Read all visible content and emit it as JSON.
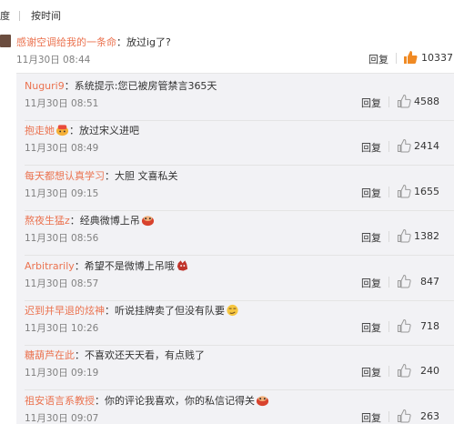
{
  "sort": {
    "by_heat": "度",
    "by_time": "按时间"
  },
  "main": {
    "user": "感谢空调给我的一条命",
    "text": "：放过ig了?",
    "time": "11月30日 08:44",
    "reply": "回复",
    "likes": "10337",
    "like_color": "#f08a24"
  },
  "replies": [
    {
      "user": "Nuguri9",
      "text": "：系统提示:您已被房管禁言365天",
      "time": "11月30日 08:51",
      "reply": "回复",
      "likes": "4588",
      "emoji": ""
    },
    {
      "user": "抱走她",
      "text": "：放过宋义进吧",
      "time": "11月30日 08:49",
      "reply": "回复",
      "likes": "2414",
      "emoji": "badge-icon"
    },
    {
      "user": "每天都想认真学习",
      "text": "：大胆 文喜私关",
      "time": "11月30日 09:15",
      "reply": "回复",
      "likes": "1655",
      "emoji": ""
    },
    {
      "user": "熬夜生猛z",
      "text": "：经典微博上吊",
      "time": "11月30日 08:56",
      "reply": "回复",
      "likes": "1382",
      "emoji": "doge-red-icon"
    },
    {
      "user": "Arbitrarily",
      "text": "：希望不是微博上吊哦",
      "time": "11月30日 08:57",
      "reply": "回复",
      "likes": "847",
      "emoji": "monster-icon"
    },
    {
      "user": "迟到并早退的炫神",
      "text": "：听说挂牌卖了但没有队要",
      "time": "11月30日 10:26",
      "reply": "回复",
      "likes": "718",
      "emoji": "smirk-icon"
    },
    {
      "user": "糖葫芦在此",
      "text": "：不喜欢还天天看，有点贱了",
      "time": "11月30日 09:19",
      "reply": "回复",
      "likes": "240",
      "emoji": ""
    },
    {
      "user": "祖安语言系教授",
      "text": "：你的评论我喜欢，你的私信记得关",
      "time": "11月30日 09:07",
      "reply": "回复",
      "likes": "263",
      "emoji": "doge-red-icon"
    }
  ],
  "colors": {
    "username": "#eb7350",
    "sub_bg": "#f2f2f5",
    "time": "#808080"
  }
}
